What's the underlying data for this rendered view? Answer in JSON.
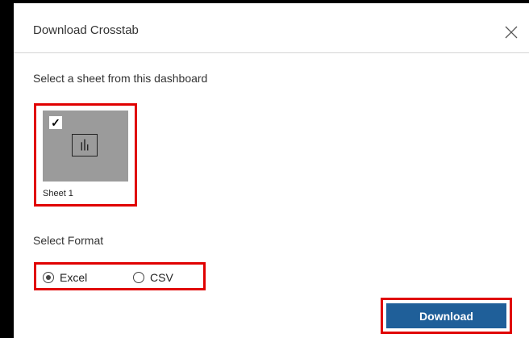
{
  "dialog": {
    "title": "Download Crosstab",
    "close_icon": "close-icon"
  },
  "sheet_section": {
    "label": "Select a sheet from this dashboard",
    "sheets": [
      {
        "name": "Sheet 1",
        "selected": true,
        "icon": "bar-chart-icon"
      }
    ]
  },
  "format_section": {
    "label": "Select Format",
    "options": [
      {
        "label": "Excel",
        "selected": true
      },
      {
        "label": "CSV",
        "selected": false
      }
    ]
  },
  "actions": {
    "download_label": "Download"
  },
  "colors": {
    "primary_button": "#1f5f99",
    "highlight_outline": "#e00000",
    "thumbnail_bg": "#9b9b9b"
  }
}
